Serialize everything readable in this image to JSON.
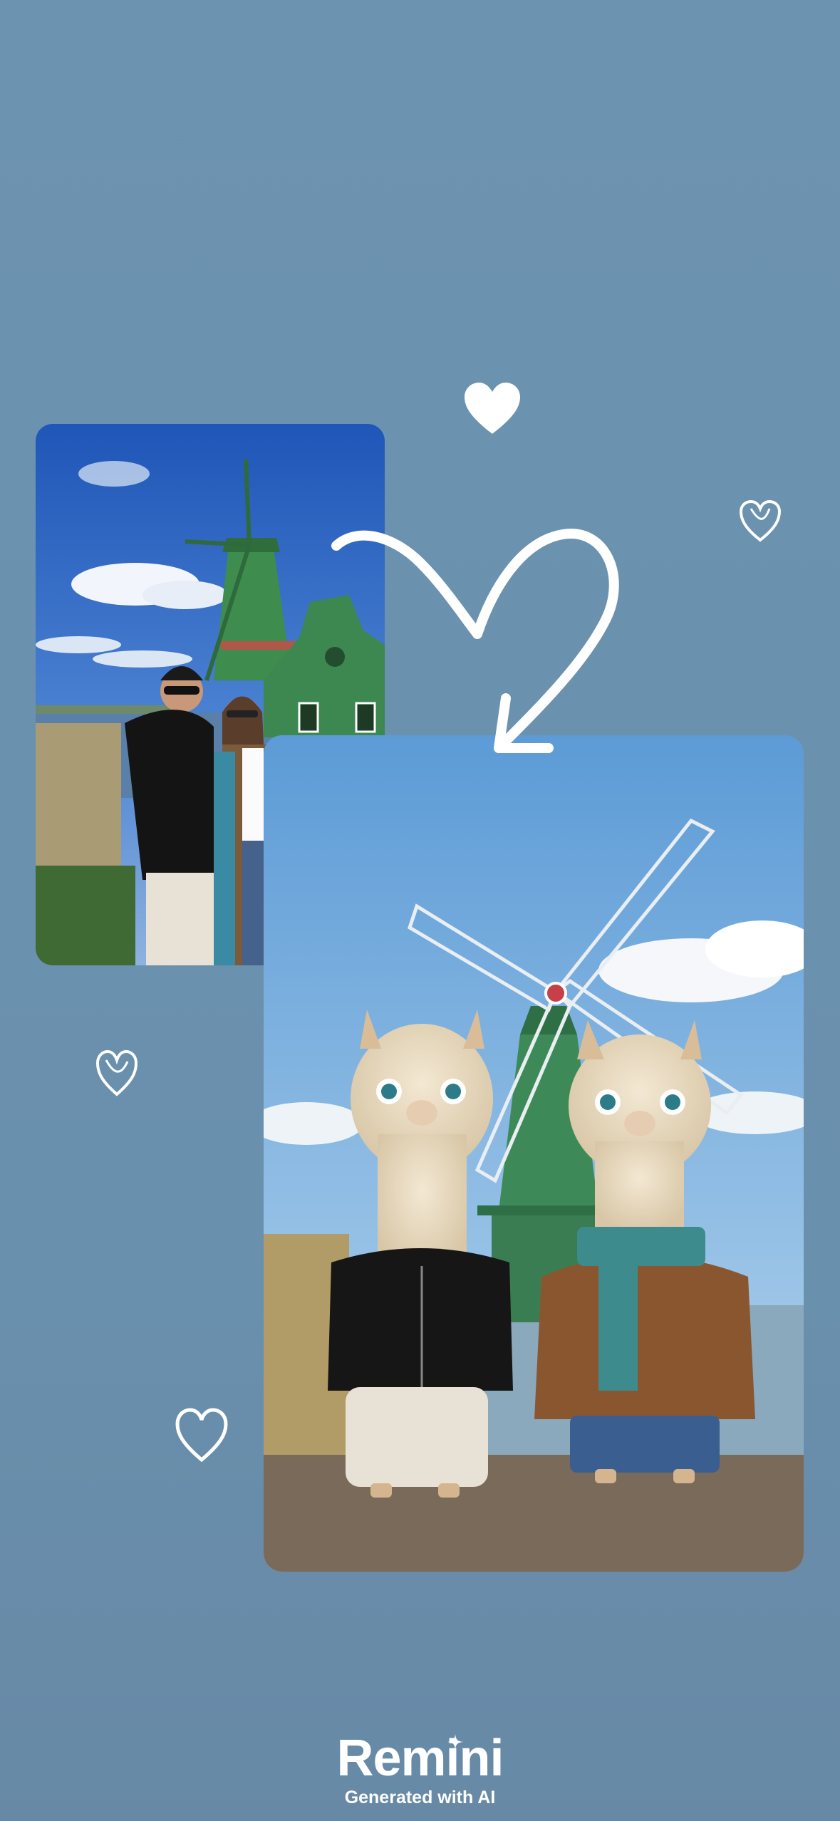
{
  "brand": {
    "name": "Remini",
    "tagline": "Generated with AI"
  },
  "images": {
    "original": "original-couple-photo-icon",
    "generated": "ai-alpaca-couple-image-icon"
  },
  "decorations": [
    "heart-icon",
    "curved-arrow-icon"
  ],
  "colors": {
    "background": "#6c93b0",
    "text": "#ffffff",
    "sky": "#3b74c7",
    "windmill_green": "#3e8a5a"
  }
}
